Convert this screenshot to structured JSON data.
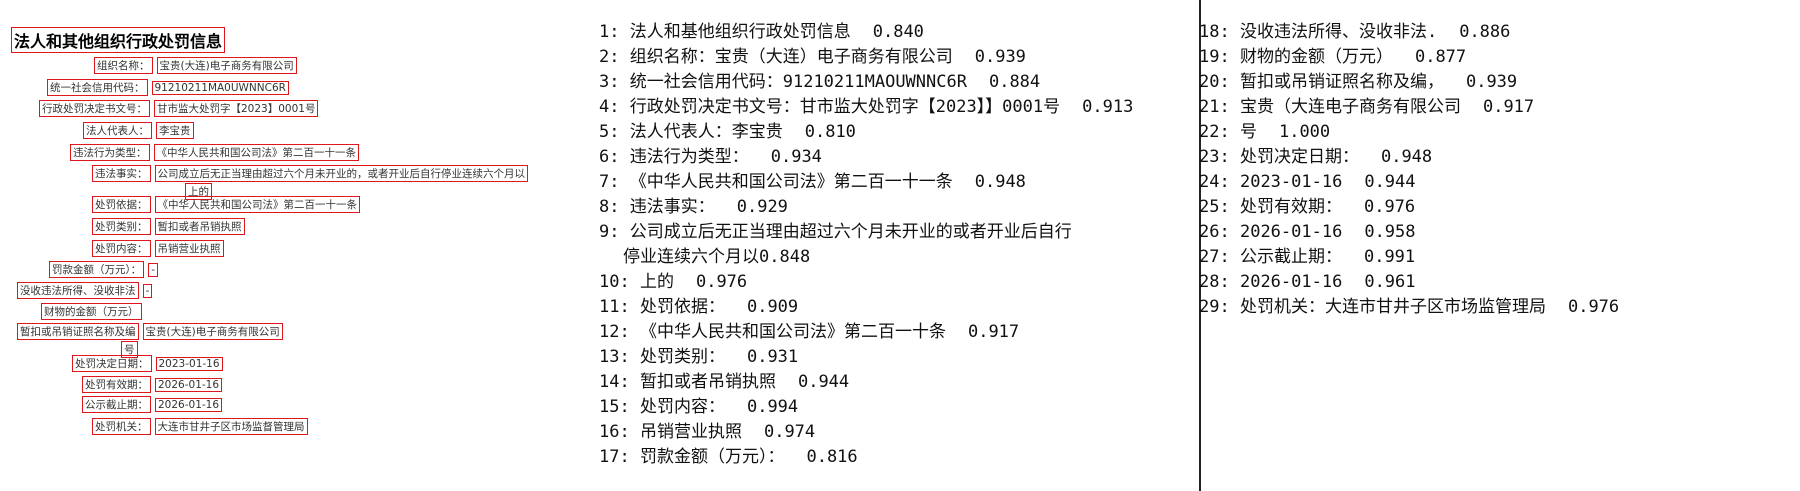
{
  "document": {
    "title": "法人和其他组织行政处罚信息",
    "rows": [
      {
        "label": "组织名称：",
        "value": "宝贵(大连)电子商务有限公司"
      },
      {
        "label": "统一社会信用代码：",
        "value": "91210211MA0UWNNC6R"
      },
      {
        "label": "行政处罚决定书文号：",
        "value": "甘市监大处罚字【2023】0001号"
      },
      {
        "label": "法人代表人：",
        "value": "李宝贵"
      },
      {
        "label": "违法行为类型：",
        "value": "《中华人民共和国公司法》第二百一十一条"
      },
      {
        "label": "违法事实：",
        "value": "公司成立后无正当理由超过六个月未开业的，或者开业后自行停业连续六个月以",
        "value2": "上的"
      },
      {
        "label": "处罚依据：",
        "value": "《中华人民共和国公司法》第二百一十一条"
      },
      {
        "label": "处罚类别：",
        "value": "暂扣或者吊销执照"
      },
      {
        "label": "处罚内容：",
        "value": "吊销营业执照"
      },
      {
        "label": "罚款金额（万元）：",
        "value": "-"
      },
      {
        "label": "没收违法所得、没收非法",
        "value": "-"
      },
      {
        "label": "财物的金额（万元）",
        "value": ""
      },
      {
        "label": "暂扣或吊销证照名称及编",
        "value": "宝贵(大连)电子商务有限公司",
        "value2": "号"
      },
      {
        "label": "处罚决定日期：",
        "value": "2023-01-16"
      },
      {
        "label": "处罚有效期：",
        "value": "2026-01-16"
      },
      {
        "label": "公示截止期：",
        "value": "2026-01-16"
      },
      {
        "label": "处罚机关：",
        "value": "大连市甘井子区市场监督管理局"
      }
    ]
  },
  "ocr_results": [
    {
      "n": "1",
      "text": "法人和基他组织行政处罚信息",
      "score": "0.840"
    },
    {
      "n": "2",
      "text": "组织名称：宝贵（大连）电子商务有限公司",
      "score": "0.939"
    },
    {
      "n": "3",
      "text": "统一社会信用代码：91210211MAOUWNNC6R",
      "score": "0.884"
    },
    {
      "n": "4",
      "text": "行政处罚决定书文号：甘市监大处罚字【2023】】0001号",
      "score": "0.913"
    },
    {
      "n": "5",
      "text": "法人代表人：李宝贵",
      "score": "0.810"
    },
    {
      "n": "6",
      "text": "违法行为类型：",
      "score": "0.934"
    },
    {
      "n": "7",
      "text": "《中华人民共和国公司法》第二百一十一条",
      "score": "0.948"
    },
    {
      "n": "8",
      "text": "违法事实：",
      "score": "0.929"
    },
    {
      "n": "9",
      "text": "公司成立后无正当理由超过六个月未开业的或者开业后自行",
      "text2": "停业连续六个月以",
      "score": "0.848"
    },
    {
      "n": "10",
      "text": "上的",
      "score": "0.976"
    },
    {
      "n": "11",
      "text": "处罚依据：",
      "score": "0.909"
    },
    {
      "n": "12",
      "text": "《中华人民共和国公司法》第二百一十条",
      "score": "0.917"
    },
    {
      "n": "13",
      "text": "处罚类别：",
      "score": "0.931"
    },
    {
      "n": "14",
      "text": "暂扣或者吊销执照",
      "score": "0.944"
    },
    {
      "n": "15",
      "text": "处罚内容：",
      "score": "0.994"
    },
    {
      "n": "16",
      "text": "吊销营业执照",
      "score": "0.974"
    },
    {
      "n": "17",
      "text": "罚款金额（万元）：",
      "score": "0.816"
    },
    {
      "n": "18",
      "text": "没收违法所得、没收非法.",
      "score": "0.886"
    },
    {
      "n": "19",
      "text": "财物的金额（万元）",
      "score": "0.877"
    },
    {
      "n": "20",
      "text": "暂扣或吊销证照名称及编，",
      "score": "0.939"
    },
    {
      "n": "21",
      "text": "宝贵（大连电子商务有限公司",
      "score": "0.917"
    },
    {
      "n": "22",
      "text": "号",
      "score": "1.000"
    },
    {
      "n": "23",
      "text": "处罚决定日期：",
      "score": "0.948"
    },
    {
      "n": "24",
      "text": "2023-01-16",
      "score": "0.944"
    },
    {
      "n": "25",
      "text": "处罚有效期：",
      "score": "0.976"
    },
    {
      "n": "26",
      "text": "2026-01-16",
      "score": "0.958"
    },
    {
      "n": "27",
      "text": "公示截止期：",
      "score": "0.991"
    },
    {
      "n": "28",
      "text": "2026-01-16",
      "score": "0.961"
    },
    {
      "n": "29",
      "text": "处罚机关：大连市甘井子区市场监管理局",
      "score": "0.976"
    }
  ],
  "colors": {
    "box": "#e0161d"
  }
}
